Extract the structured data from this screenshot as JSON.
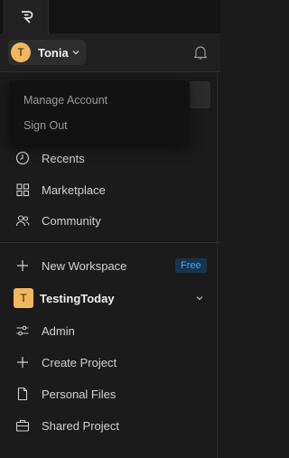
{
  "app": {
    "logo_icon": "r-logo-icon"
  },
  "user": {
    "initial": "T",
    "name": "Tonia",
    "avatar_color": "#f0b85f"
  },
  "account_menu": {
    "items": [
      {
        "label": "Manage Account"
      },
      {
        "label": "Sign Out"
      }
    ]
  },
  "nav": {
    "top_items": [
      {
        "label": "Recents",
        "icon": "clock-icon"
      },
      {
        "label": "Marketplace",
        "icon": "grid-icon"
      },
      {
        "label": "Community",
        "icon": "users-icon"
      }
    ],
    "new_workspace": {
      "label": "New Workspace",
      "badge": "Free",
      "icon": "plus-icon"
    },
    "workspace": {
      "initial": "T",
      "name": "TestingToday",
      "color": "#f0b85f"
    },
    "workspace_items": [
      {
        "label": "Admin",
        "icon": "sliders-icon"
      },
      {
        "label": "Create Project",
        "icon": "plus-icon"
      },
      {
        "label": "Personal Files",
        "icon": "file-icon"
      },
      {
        "label": "Shared Project",
        "icon": "briefcase-icon"
      }
    ]
  },
  "colors": {
    "background": "#1b1b1b",
    "badge_bg": "#15344d",
    "badge_text": "#4ea7e8"
  }
}
